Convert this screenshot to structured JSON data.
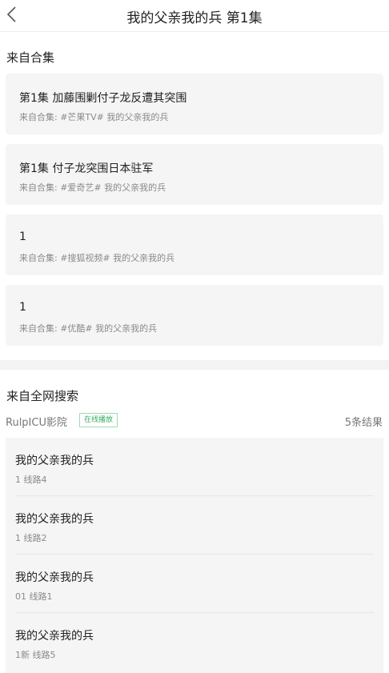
{
  "header": {
    "back_icon": "chevron-left-icon",
    "title": "我的父亲我的兵 第1集"
  },
  "collections": {
    "section_title": "来自合集",
    "items": [
      {
        "title": "第1集 加藤围剿付子龙反遭其突围",
        "subtitle": "来自合集: #芒果TV# 我的父亲我的兵"
      },
      {
        "title": "第1集 付子龙突围日本驻军",
        "subtitle": "来自合集: #爱奇艺# 我的父亲我的兵"
      },
      {
        "title": "1",
        "subtitle": "来自合集: #搜狐视频# 我的父亲我的兵"
      },
      {
        "title": "1",
        "subtitle": "来自合集: #优酷# 我的父亲我的兵"
      }
    ]
  },
  "web_search": {
    "section_title": "来自全网搜索",
    "source_name": "RulpICU影院",
    "badge": "在线播放",
    "result_count": "5条结果",
    "results": [
      {
        "title": "我的父亲我的兵",
        "subtitle": "1 线路4"
      },
      {
        "title": "我的父亲我的兵",
        "subtitle": "1 线路2"
      },
      {
        "title": "我的父亲我的兵",
        "subtitle": "01 线路1"
      },
      {
        "title": "我的父亲我的兵",
        "subtitle": "1新 线路5"
      }
    ]
  },
  "colors": {
    "card_bg": "#f5f5f5",
    "badge_green": "#3aaa63",
    "muted_text": "#8a8a8a"
  }
}
